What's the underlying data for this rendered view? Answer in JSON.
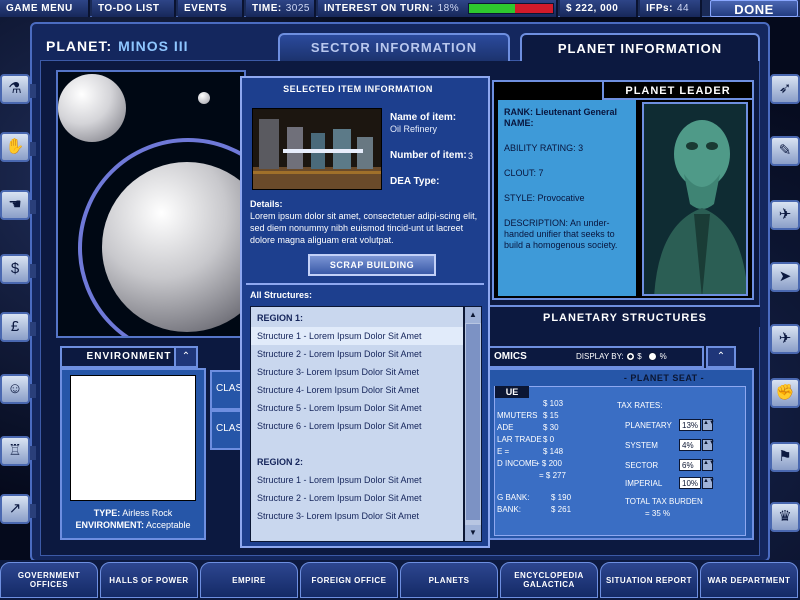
{
  "topbar": {
    "game_menu": "GAME MENU",
    "todo_list": "TO-DO LIST",
    "events": "EVENTS",
    "time_label": "TIME:",
    "time_value": "3025",
    "interest_label": "INTEREST ON TURN:",
    "interest_value": "18%",
    "interest_fill_fraction": 0.55,
    "money": "$ 222, 000",
    "ifps_label": "IFPs:",
    "ifps_value": "44",
    "done": "DONE"
  },
  "header": {
    "planet_label": "PLANET:",
    "planet_name": "MINOS III",
    "sector_tab": "SECTOR INFORMATION",
    "planet_info_tab": "PLANET INFORMATION"
  },
  "left_sidebar": [
    "flask-icon",
    "handshake-icon",
    "hand-icon",
    "dollar-icon",
    "pound-icon",
    "people-icon",
    "org-chart-icon",
    "line-chart-icon"
  ],
  "right_sidebar": [
    "rocket-icon",
    "wrench-icon",
    "plane-icon",
    "fighter-icon",
    "jets-icon",
    "fist-icon",
    "flag-icon",
    "trophy-icon"
  ],
  "selected_item": {
    "title": "SELECTED ITEM INFORMATION",
    "name_label": "Name of item:",
    "name_value": "Oil Refinery",
    "number_label": "Number of item:",
    "number_value": "3",
    "dea_label": "DEA Type:",
    "details_label": "Details:",
    "details_text": "Lorem ipsum dolor sit amet, consectetuer adipi-scing elit, sed diem nonummy nibh euismod tincid-unt ut lacreet dolore magna aliguam erat volutpat.",
    "scrap_button": "SCRAP BUILDING",
    "all_structures_label": "All Structures:",
    "region1": "REGION 1:",
    "region1_items": [
      "Structure 1 - Lorem Ipsum Dolor Sit Amet",
      "Structure 2 - Lorem Ipsum Dolor Sit Amet",
      "Structure 3- Lorem Ipsum Dolor Sit Amet",
      "Structure 4- Lorem Ipsum Dolor Sit Amet",
      "Structure 5 - Lorem Ipsum Dolor Sit Amet",
      "Structure 6 - Lorem Ipsum Dolor Sit Amet"
    ],
    "region2": "REGION 2:",
    "region2_items": [
      "Structure 1 - Lorem Ipsum Dolor Sit Amet",
      "Structure 2 - Lorem Ipsum Dolor Sit Amet",
      "Structure 3- Lorem Ipsum Dolor Sit Amet"
    ]
  },
  "leader": {
    "header": "PLANET LEADER",
    "rank": "RANK: Lieutenant General",
    "name_label": "NAME:",
    "ability": "ABILITY RATING:  3",
    "clout": "CLOUT:  7",
    "style": "STYLE: Provocative",
    "description": "DESCRIPTION: An under-handed unifier that seeks to build a homogenous society."
  },
  "planetary_structures": "PLANETARY STRUCTURES",
  "environment": {
    "header": "ENVIRONMENT",
    "type_label": "TYPE:",
    "type_value": "Airless Rock",
    "env_label": "ENVIRONMENT:",
    "env_value": "Acceptable",
    "class_label_1": "CLAS",
    "class_label_2": "CLAS"
  },
  "economics": {
    "header": "OMICS",
    "display_by": "DISPLAY BY:",
    "opt_dollar": "$",
    "opt_percent": "%",
    "seat": "- PLANET SEAT -",
    "tab": "UE",
    "rows": [
      {
        "label": "",
        "value": "$ 103"
      },
      {
        "label": "MMUTERS",
        "value": "$ 15"
      },
      {
        "label": "ADE",
        "value": "$ 30"
      },
      {
        "label": "LAR TRADE",
        "value": "$ 0"
      },
      {
        "label": "E =",
        "value": "$ 148"
      },
      {
        "label": "D INCOME",
        "value": "+  $ 200"
      },
      {
        "label": "",
        "value": "= $ 277"
      },
      {
        "label": "G BANK:",
        "value": "$ 190"
      },
      {
        "label": "BANK:",
        "value": "$ 261"
      }
    ],
    "tax_rates_label": "TAX RATES:",
    "tax": [
      {
        "label": "PLANETARY",
        "value": "13%"
      },
      {
        "label": "SYSTEM",
        "value": "4%"
      },
      {
        "label": "SECTOR",
        "value": "6%"
      },
      {
        "label": "IMPERIAL",
        "value": "10%"
      }
    ],
    "total_label": "TOTAL TAX BURDEN",
    "total_value": "= 35 %"
  },
  "bottom_tabs": [
    "GOVERNMENT OFFICES",
    "HALLS OF POWER",
    "EMPIRE",
    "FOREIGN OFFICE",
    "PLANETS",
    "ENCYCLOPEDIA GALACTICA",
    "SITUATION REPORT",
    "WAR DEPARTMENT"
  ],
  "colors": {
    "accent_blue": "#6e8fe0",
    "panel_blue": "#2656a8",
    "leader_blue": "#3e9ad8",
    "interest_good": "#2ec82e",
    "interest_bad": "#d11b2a"
  }
}
